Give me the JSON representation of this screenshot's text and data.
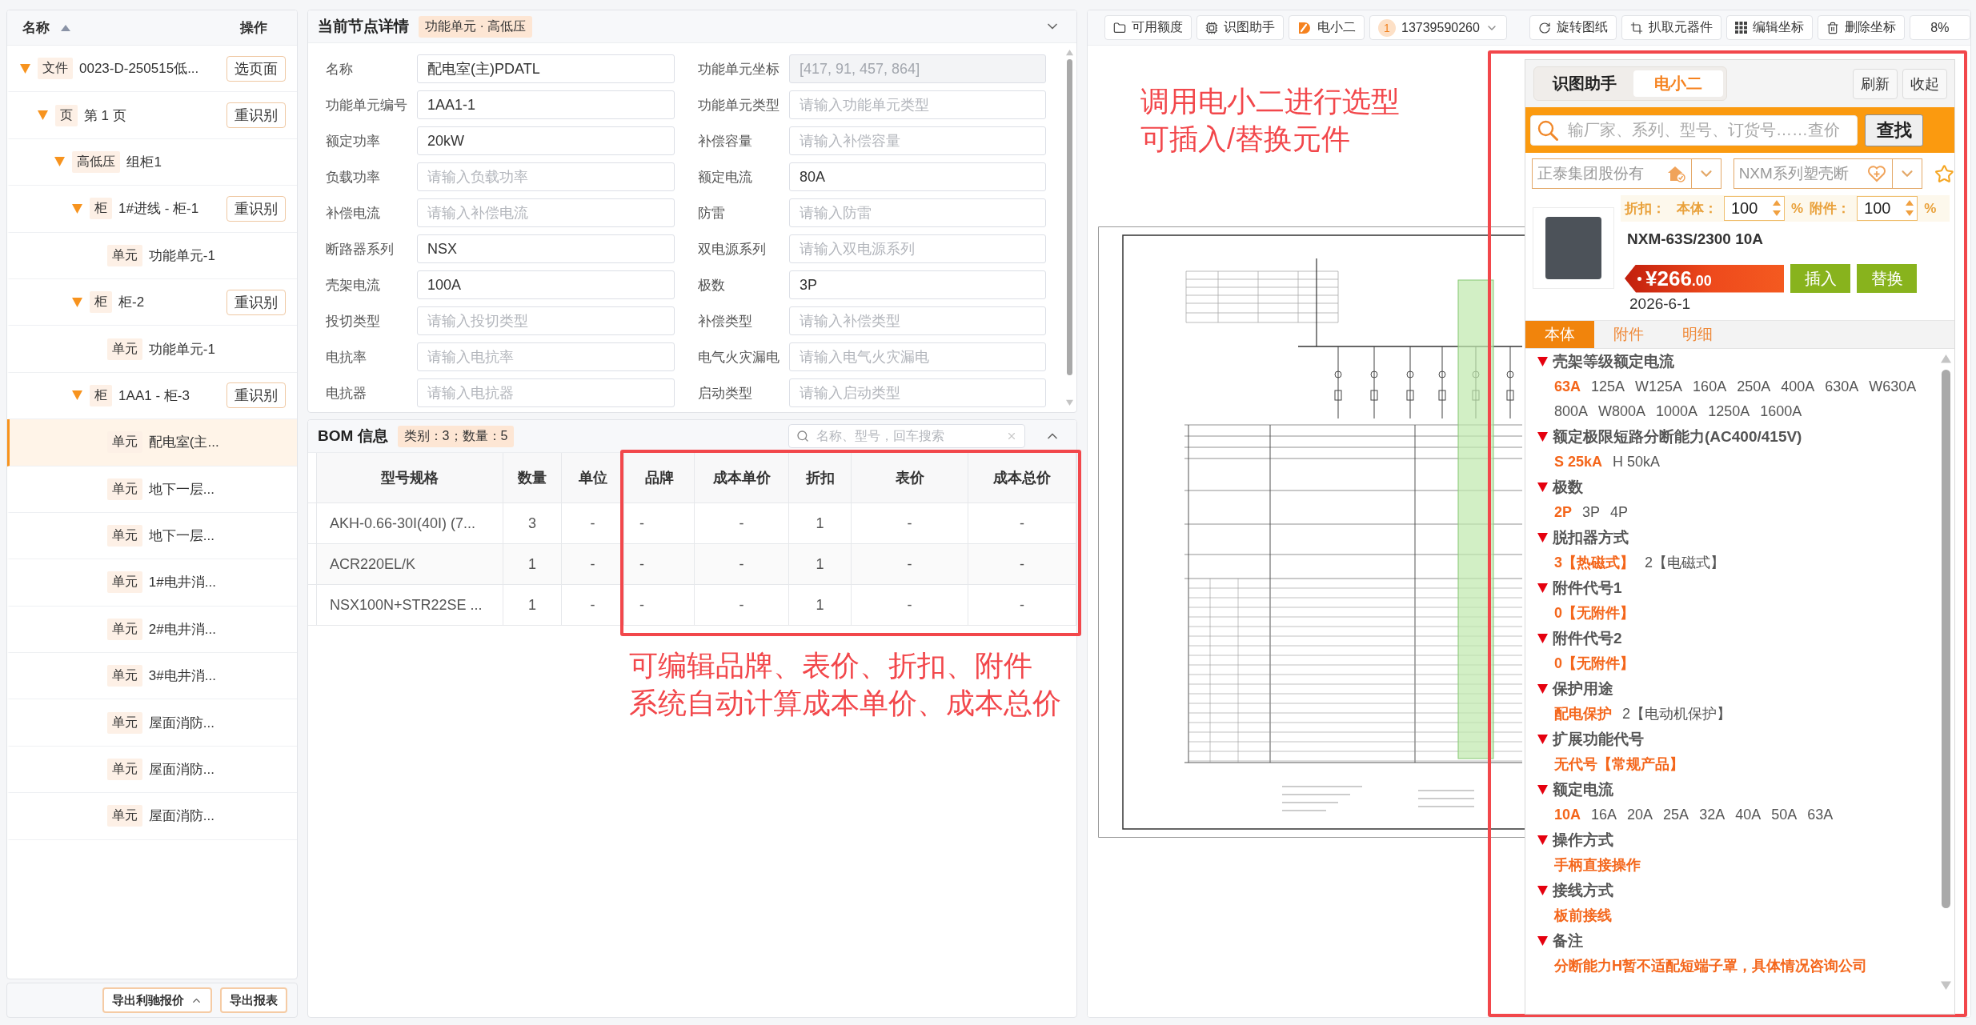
{
  "tree": {
    "columns": [
      "名称",
      "操作"
    ],
    "nodes": [
      {
        "tag": "文件",
        "label": "0023-D-250515低...",
        "action": "选页面",
        "expanded": true,
        "selected": false,
        "children": [
          {
            "tag": "页",
            "label": "第 1 页",
            "action": "重识别",
            "expanded": true,
            "selected": false,
            "children": [
              {
                "tag": "高低压",
                "label": "组柜1",
                "expanded": true,
                "selected": false,
                "children": [
                  {
                    "tag": "柜",
                    "label": "1#进线 - 柜-1",
                    "action": "重识别",
                    "expanded": true,
                    "selected": false,
                    "children": [
                      {
                        "tag": "单元",
                        "label": "功能单元-1",
                        "selected": false
                      }
                    ]
                  },
                  {
                    "tag": "柜",
                    "label": "柜-2",
                    "action": "重识别",
                    "expanded": true,
                    "selected": false,
                    "children": [
                      {
                        "tag": "单元",
                        "label": "功能单元-1",
                        "selected": false
                      }
                    ]
                  },
                  {
                    "tag": "柜",
                    "label": "1AA1 - 柜-3",
                    "action": "重识别",
                    "expanded": true,
                    "selected": false,
                    "children": [
                      {
                        "tag": "单元",
                        "label": "配电室(主...",
                        "selected": true
                      },
                      {
                        "tag": "单元",
                        "label": "地下一层...",
                        "selected": false
                      },
                      {
                        "tag": "单元",
                        "label": "地下一层...",
                        "selected": false
                      },
                      {
                        "tag": "单元",
                        "label": "1#电井消...",
                        "selected": false
                      },
                      {
                        "tag": "单元",
                        "label": "2#电井消...",
                        "selected": false
                      },
                      {
                        "tag": "单元",
                        "label": "3#电井消...",
                        "selected": false
                      },
                      {
                        "tag": "单元",
                        "label": "屋面消防...",
                        "selected": false
                      },
                      {
                        "tag": "单元",
                        "label": "屋面消防...",
                        "selected": false
                      },
                      {
                        "tag": "单元",
                        "label": "屋面消防...",
                        "selected": false
                      }
                    ]
                  }
                ]
              }
            ]
          }
        ]
      }
    ]
  },
  "export_buttons": [
    {
      "label": "导出利驰报价",
      "kind": "dropdown"
    },
    {
      "label": "导出报表",
      "kind": "plain"
    }
  ],
  "detail": {
    "title": "当前节点详情",
    "badge": "功能单元 · 高低压",
    "fields": [
      {
        "label": "名称",
        "value": "配电室(主)PDATL",
        "disabled": false
      },
      {
        "label": "功能单元坐标",
        "value": "[417, 91, 457, 864]",
        "disabled": true
      },
      {
        "label": "功能单元编号",
        "value": "1AA1-1",
        "disabled": false
      },
      {
        "label": "功能单元类型",
        "placeholder": "请输入功能单元类型",
        "disabled": false
      },
      {
        "label": "额定功率",
        "value": "20kW",
        "disabled": false
      },
      {
        "label": "补偿容量",
        "placeholder": "请输入补偿容量",
        "disabled": false
      },
      {
        "label": "负载功率",
        "placeholder": "请输入负载功率",
        "disabled": false
      },
      {
        "label": "额定电流",
        "value": "80A",
        "disabled": false
      },
      {
        "label": "补偿电流",
        "placeholder": "请输入补偿电流",
        "disabled": false
      },
      {
        "label": "防雷",
        "placeholder": "请输入防雷",
        "disabled": false
      },
      {
        "label": "断路器系列",
        "value": "NSX",
        "disabled": false
      },
      {
        "label": "双电源系列",
        "placeholder": "请输入双电源系列",
        "disabled": false
      },
      {
        "label": "壳架电流",
        "value": "100A",
        "disabled": false
      },
      {
        "label": "极数",
        "value": "3P",
        "disabled": false
      },
      {
        "label": "投切类型",
        "placeholder": "请输入投切类型",
        "disabled": false
      },
      {
        "label": "补偿类型",
        "placeholder": "请输入补偿类型",
        "disabled": false
      },
      {
        "label": "电抗率",
        "placeholder": "请输入电抗率",
        "disabled": false
      },
      {
        "label": "电气火灾漏电",
        "placeholder": "请输入电气火灾漏电",
        "disabled": false
      },
      {
        "label": "电抗器",
        "placeholder": "请输入电抗器",
        "disabled": false
      },
      {
        "label": "启动类型",
        "placeholder": "请输入启动类型",
        "disabled": false
      }
    ]
  },
  "bom": {
    "title": "BOM 信息",
    "badge": "类别：3；数量：5",
    "search": {
      "placeholder": "名称、型号，回车搜索"
    },
    "columns": [
      "型号规格",
      "数量",
      "单位",
      "品牌",
      "成本单价",
      "折扣",
      "表价",
      "成本总价"
    ],
    "rows": [
      [
        "AKH-0.66-30I(40I) (7...",
        "3",
        "-",
        "-",
        "-",
        "1",
        "-",
        "-"
      ],
      [
        "ACR220EL/K",
        "1",
        "-",
        "-",
        "-",
        "1",
        "-",
        "-"
      ],
      [
        "NSX100N+STR22SE ...",
        "1",
        "-",
        "-",
        "-",
        "1",
        "-",
        "-"
      ]
    ],
    "annotation": [
      "可编辑品牌、表价、折扣、附件",
      "系统自动计算成本单价、成本总价"
    ]
  },
  "toolbar": {
    "left": [
      {
        "label": "可用额度"
      },
      {
        "label": "识图助手"
      },
      {
        "label": "电小二"
      }
    ],
    "account": {
      "badge": "1",
      "number": "13739590260"
    },
    "right": [
      {
        "label": "旋转图纸"
      },
      {
        "label": "扒取元器件"
      },
      {
        "label": "编辑坐标"
      },
      {
        "label": "删除坐标"
      }
    ],
    "zoom": "8%"
  },
  "canvas": {
    "annotation": [
      "调用电小二进行选型",
      "可插入/替换元件"
    ]
  },
  "assistant": {
    "tabs": [
      {
        "label": "识图助手",
        "selected": false
      },
      {
        "label": "电小二",
        "selected": true
      }
    ],
    "buttons": [
      "刷新",
      "收起"
    ],
    "search": {
      "placeholder": "输厂家、系列、型号、订货号……查价",
      "button": "查找"
    },
    "selects": [
      {
        "value": "正泰集团股份有"
      },
      {
        "value": "NXM系列塑壳断"
      }
    ],
    "discount": {
      "label": "折扣：",
      "items": [
        {
          "label": "本体：",
          "value": "100",
          "unit": "%"
        },
        {
          "label": "附件：",
          "value": "100",
          "unit": "%"
        }
      ]
    },
    "product": {
      "model": "NXM-63S/2300 10A",
      "price": {
        "whole": "¥266",
        "fraction": ".00"
      },
      "actions": [
        "插入",
        "替换"
      ],
      "date": "2026-6-1"
    },
    "detail_tabs": [
      {
        "label": "本体",
        "selected": true
      },
      {
        "label": "附件",
        "selected": false
      },
      {
        "label": "明细",
        "selected": false
      }
    ],
    "attributes": [
      {
        "title": "壳架等级额定电流",
        "options": [
          {
            "label": "63A",
            "selected": true
          },
          {
            "label": "125A",
            "selected": false
          },
          {
            "label": "W125A",
            "selected": false
          },
          {
            "label": "160A",
            "selected": false
          },
          {
            "label": "250A",
            "selected": false
          },
          {
            "label": "400A",
            "selected": false
          },
          {
            "label": "630A",
            "selected": false
          },
          {
            "label": "W630A",
            "selected": false
          },
          {
            "label": "800A",
            "selected": false
          },
          {
            "label": "W800A",
            "selected": false
          },
          {
            "label": "1000A",
            "selected": false
          },
          {
            "label": "1250A",
            "selected": false
          },
          {
            "label": "1600A",
            "selected": false
          }
        ]
      },
      {
        "title": "额定极限短路分断能力(AC400/415V)",
        "options": [
          {
            "label": "S 25kA",
            "selected": true
          },
          {
            "label": "H 50kA",
            "selected": false
          }
        ]
      },
      {
        "title": "极数",
        "options": [
          {
            "label": "2P",
            "selected": true
          },
          {
            "label": "3P",
            "selected": false
          },
          {
            "label": "4P",
            "selected": false
          }
        ]
      },
      {
        "title": "脱扣器方式",
        "options": [
          {
            "label": "3【热磁式】",
            "selected": true
          },
          {
            "label": "2【电磁式】",
            "selected": false
          }
        ]
      },
      {
        "title": "附件代号1",
        "options": [
          {
            "label": "0【无附件】",
            "selected": true
          }
        ]
      },
      {
        "title": "附件代号2",
        "options": [
          {
            "label": "0【无附件】",
            "selected": true
          }
        ]
      },
      {
        "title": "保护用途",
        "options": [
          {
            "label": "配电保护",
            "selected": true
          },
          {
            "label": "2【电动机保护】",
            "selected": false
          }
        ]
      },
      {
        "title": "扩展功能代号",
        "options": [
          {
            "label": "无代号【常规产品】",
            "selected": true
          }
        ]
      },
      {
        "title": "额定电流",
        "options": [
          {
            "label": "10A",
            "selected": true
          },
          {
            "label": "16A",
            "selected": false
          },
          {
            "label": "20A",
            "selected": false
          },
          {
            "label": "25A",
            "selected": false
          },
          {
            "label": "32A",
            "selected": false
          },
          {
            "label": "40A",
            "selected": false
          },
          {
            "label": "50A",
            "selected": false
          },
          {
            "label": "63A",
            "selected": false
          }
        ]
      },
      {
        "title": "操作方式",
        "options": [
          {
            "label": "手柄直接操作",
            "selected": true
          }
        ]
      },
      {
        "title": "接线方式",
        "options": [
          {
            "label": "板前接线",
            "selected": true
          }
        ]
      },
      {
        "title": "备注",
        "options": [
          {
            "label": "分断能力H暂不适配短端子罩，具体情况咨询公司",
            "selected": true
          }
        ]
      }
    ]
  }
}
